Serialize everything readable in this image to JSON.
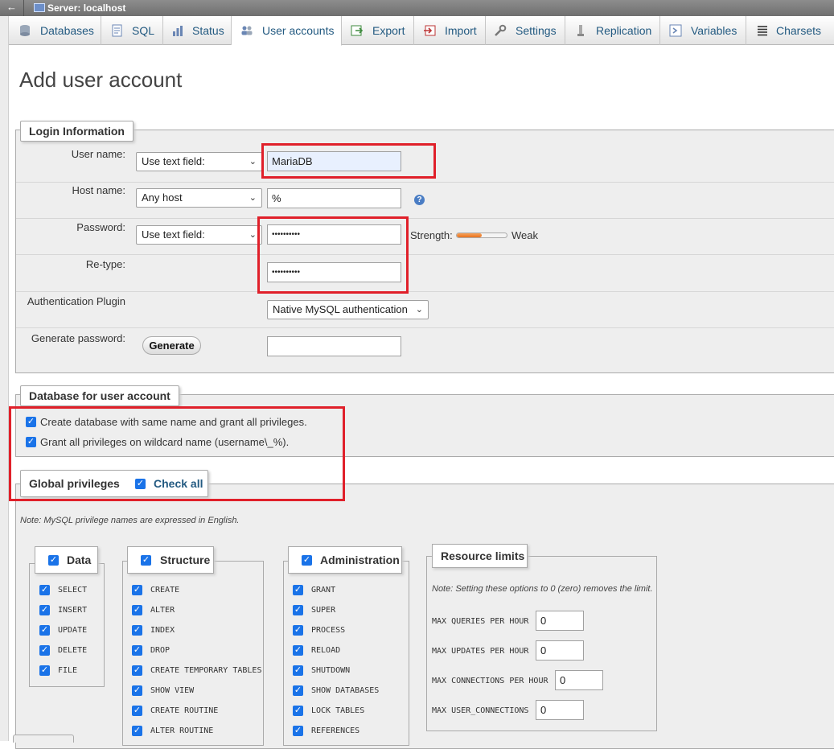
{
  "topbar": {
    "back": "←",
    "server": "Server: localhost"
  },
  "tabs": [
    {
      "label": "Databases",
      "icon": "database-icon"
    },
    {
      "label": "SQL",
      "icon": "sql-icon"
    },
    {
      "label": "Status",
      "icon": "status-icon"
    },
    {
      "label": "User accounts",
      "icon": "users-icon"
    },
    {
      "label": "Export",
      "icon": "export-icon"
    },
    {
      "label": "Import",
      "icon": "import-icon"
    },
    {
      "label": "Settings",
      "icon": "wrench-icon"
    },
    {
      "label": "Replication",
      "icon": "replication-icon"
    },
    {
      "label": "Variables",
      "icon": "variables-icon"
    },
    {
      "label": "Charsets",
      "icon": "charsets-icon"
    }
  ],
  "page_title": "Add user account",
  "login": {
    "legend": "Login Information",
    "username_label": "User name:",
    "username_select": "Use text field:",
    "username_value": "MariaDB",
    "host_label": "Host name:",
    "host_select": "Any host",
    "host_value": "%",
    "password_label": "Password:",
    "password_select": "Use text field:",
    "password_value": "••••••••••",
    "strength_label": "Strength:",
    "strength_text": "Weak",
    "strength_fraction": 0.5,
    "retype_label": "Re-type:",
    "retype_value": "••••••••••",
    "auth_label": "Authentication Plugin",
    "auth_value": "Native MySQL authentication",
    "generate_label": "Generate password:",
    "generate_button": "Generate",
    "generated_value": ""
  },
  "database": {
    "legend": "Database for user account",
    "options": [
      {
        "label": "Create database with same name and grant all privileges.",
        "checked": true
      },
      {
        "label": "Grant all privileges on wildcard name (username\\_%).",
        "checked": true
      }
    ]
  },
  "global": {
    "legend": "Global privileges",
    "check_all": "Check all",
    "note": "Note: MySQL privilege names are expressed in English."
  },
  "groups": {
    "data": {
      "title": "Data",
      "items": [
        "SELECT",
        "INSERT",
        "UPDATE",
        "DELETE",
        "FILE"
      ]
    },
    "structure": {
      "title": "Structure",
      "items": [
        "CREATE",
        "ALTER",
        "INDEX",
        "DROP",
        "CREATE TEMPORARY TABLES",
        "SHOW VIEW",
        "CREATE ROUTINE",
        "ALTER ROUTINE"
      ]
    },
    "administration": {
      "title": "Administration",
      "items": [
        "GRANT",
        "SUPER",
        "PROCESS",
        "RELOAD",
        "SHUTDOWN",
        "SHOW DATABASES",
        "LOCK TABLES",
        "REFERENCES"
      ]
    }
  },
  "resource_limits": {
    "title": "Resource limits",
    "note": "Note: Setting these options to 0 (zero) removes the limit.",
    "items": [
      {
        "label": "MAX QUERIES PER HOUR",
        "value": "0"
      },
      {
        "label": "MAX UPDATES PER HOUR",
        "value": "0"
      },
      {
        "label": "MAX CONNECTIONS PER HOUR",
        "value": "0"
      },
      {
        "label": "MAX USER_CONNECTIONS",
        "value": "0"
      }
    ]
  },
  "colors": {
    "accent": "#1a73e8",
    "highlight": "#e0202a",
    "link": "#235a81"
  }
}
